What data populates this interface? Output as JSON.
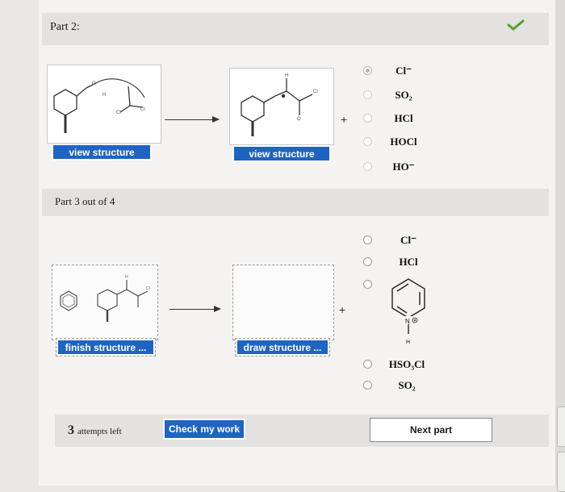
{
  "part2": {
    "title": "Part 2:",
    "view_structure_left": "view structure",
    "view_structure_right": "view structure",
    "options": [
      "Cl⁻",
      "SO₂",
      "HCl",
      "HOCl",
      "HO⁻"
    ],
    "selected_index": 0,
    "check_color": "#5aa02c"
  },
  "part3": {
    "title": "Part 3 out of 4",
    "finish_structure": "finish structure ...",
    "draw_structure": "draw structure ...",
    "options": [
      "Cl⁻",
      "HCl",
      "HSO₃Cl",
      "SO₂"
    ],
    "pyridinium_labels": {
      "n": "N",
      "h": "H"
    }
  },
  "footer": {
    "attempts_number": "3",
    "attempts_text": "attempts left",
    "check_button": "Check my work",
    "next_button": "Next part"
  },
  "colors": {
    "accent": "#1f64c2",
    "band": "#e3e2e0",
    "page": "#f4f3f1"
  }
}
